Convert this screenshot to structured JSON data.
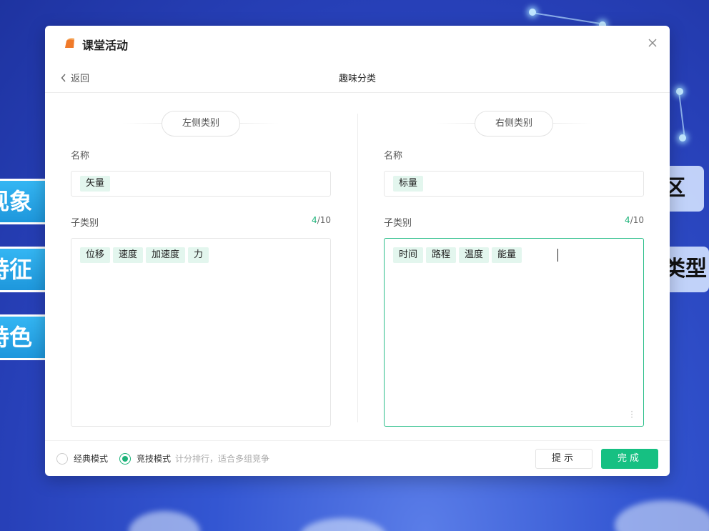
{
  "background": {
    "left_cards": [
      "现象",
      "特征",
      "特色"
    ],
    "right_cards": [
      "区",
      "类型"
    ]
  },
  "modal": {
    "title": "课堂活动",
    "nav": {
      "back_label": "返回",
      "page_title": "趣味分类"
    }
  },
  "left": {
    "section_title": "左侧类别",
    "name_label": "名称",
    "name_value": "矢量",
    "sub_label": "子类别",
    "count_current": "4",
    "count_total": "/10",
    "tags": [
      "位移",
      "速度",
      "加速度",
      "力"
    ]
  },
  "right": {
    "section_title": "右侧类别",
    "name_label": "名称",
    "name_value": "标量",
    "sub_label": "子类别",
    "count_current": "4",
    "count_total": "/10",
    "tags": [
      "时间",
      "路程",
      "温度",
      "能量"
    ]
  },
  "footer": {
    "classic_mode": "经典模式",
    "compete_mode": "竞技模式",
    "compete_desc": "计分排行，适合多组竞争",
    "hint_label": "提示",
    "done_label": "完成"
  },
  "colors": {
    "accent": "#16c082",
    "tag_bg": "#e3f6ee",
    "logo": "#f07a2a"
  }
}
